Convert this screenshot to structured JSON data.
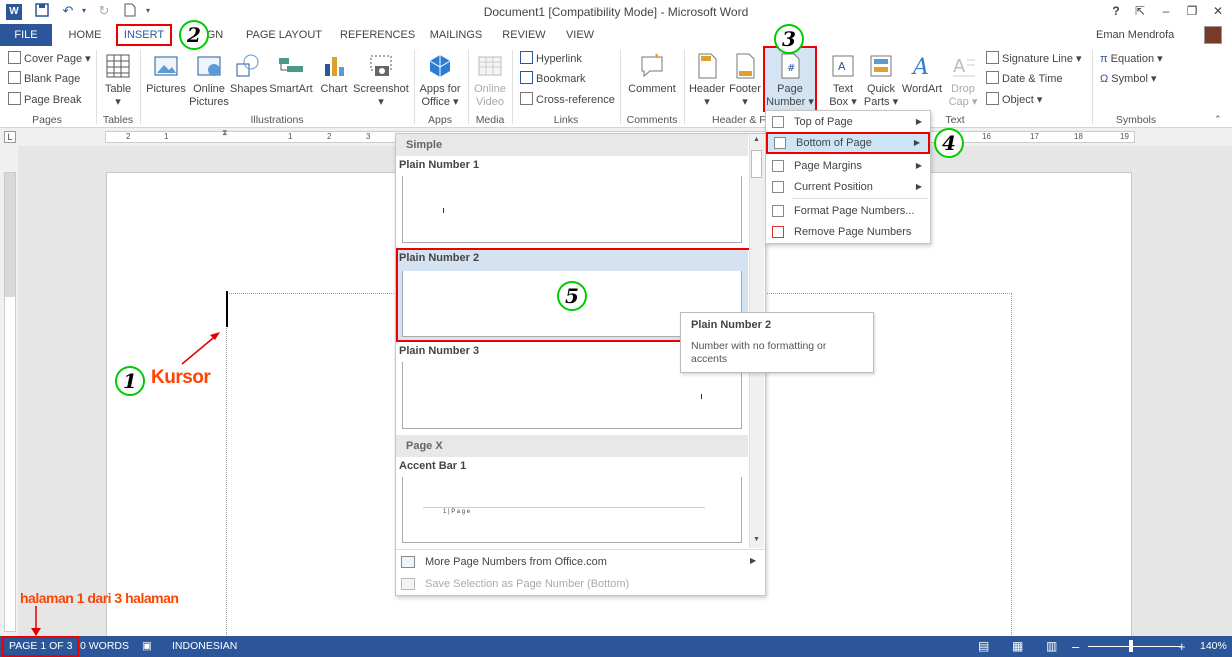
{
  "title_bar": {
    "doc_title": "Document1 [Compatibility Mode] - Microsoft Word",
    "help": "?",
    "minimize": "–",
    "restore": "❐",
    "close": "✕"
  },
  "tabs": [
    {
      "label": "FILE"
    },
    {
      "label": "HOME"
    },
    {
      "label": "INSERT"
    },
    {
      "label": "GN"
    },
    {
      "label": "PAGE LAYOUT"
    },
    {
      "label": "REFERENCES"
    },
    {
      "label": "MAILINGS"
    },
    {
      "label": "REVIEW"
    },
    {
      "label": "VIEW"
    }
  ],
  "user": {
    "name": "Eman Mendrofa"
  },
  "ribbon": {
    "pages": {
      "cover_page": "Cover Page",
      "blank_page": "Blank Page",
      "page_break": "Page Break",
      "group": "Pages"
    },
    "tables": {
      "table": "Table",
      "group": "Tables"
    },
    "illustrations": {
      "pictures": "Pictures",
      "online_pictures_1": "Online",
      "online_pictures_2": "Pictures",
      "shapes": "Shapes",
      "smartart": "SmartArt",
      "chart": "Chart",
      "screenshot": "Screenshot",
      "group": "Illustrations"
    },
    "apps": {
      "apps_1": "Apps for",
      "apps_2": "Office",
      "group": "Apps"
    },
    "media": {
      "online_video_1": "Online",
      "online_video_2": "Video",
      "group": "Media"
    },
    "links": {
      "hyperlink": "Hyperlink",
      "bookmark": "Bookmark",
      "cross_reference": "Cross-reference",
      "group": "Links"
    },
    "comments": {
      "comment": "Comment",
      "group": "Comments"
    },
    "header_footer": {
      "header": "Header",
      "footer": "Footer",
      "page_number_1": "Page",
      "page_number_2": "Number",
      "group": "Header & F"
    },
    "text": {
      "text_box_1": "Text",
      "text_box_2": "Box",
      "quick_parts_1": "Quick",
      "quick_parts_2": "Parts",
      "wordart": "WordArt",
      "drop_cap_1": "Drop",
      "drop_cap_2": "Cap",
      "signature_line": "Signature Line",
      "date_time": "Date & Time",
      "object": "Object",
      "group": "Text"
    },
    "symbols": {
      "equation": "Equation",
      "symbol": "Symbol",
      "group": "Symbols"
    }
  },
  "ruler": {
    "marks": [
      "2",
      "1",
      "1",
      "2",
      "3",
      "16",
      "17",
      "18",
      "19"
    ]
  },
  "page_number_menu": [
    {
      "label": "Top of Page"
    },
    {
      "label": "Bottom of Page"
    },
    {
      "label": "Page Margins"
    },
    {
      "label": "Current Position"
    },
    {
      "label": "Format Page Numbers..."
    },
    {
      "label": "Remove Page Numbers"
    }
  ],
  "gallery": {
    "section_simple": "Simple",
    "items": [
      {
        "title": "Plain Number 1"
      },
      {
        "title": "Plain Number 2"
      },
      {
        "title": "Plain Number 3"
      }
    ],
    "section_pagex": "Page X",
    "accent_bar": {
      "title": "Accent Bar 1",
      "sample": "1 | P a g e"
    },
    "more": "More Page Numbers from Office.com",
    "save_selection": "Save Selection as Page Number (Bottom)"
  },
  "tooltip": {
    "title": "Plain Number 2",
    "description": "Number with no formatting or accents"
  },
  "annotations": {
    "step1": "1",
    "step2": "2",
    "step3": "3",
    "step4": "4",
    "step5": "5",
    "kursor": "Kursor",
    "halaman": "halaman 1 dari 3 halaman",
    "arrow_color": "#e00000",
    "circle_color": "#00cc00"
  },
  "status_bar": {
    "page": "PAGE 1 OF 3",
    "words": "0 WORDS",
    "language": "INDONESIAN",
    "zoom": "140%",
    "zoom_level": 0.46
  },
  "colors": {
    "accent": "#2b579a",
    "highlight": "#cde6f7",
    "annotation_red": "#e00000",
    "annotation_label": "#ff4400"
  }
}
